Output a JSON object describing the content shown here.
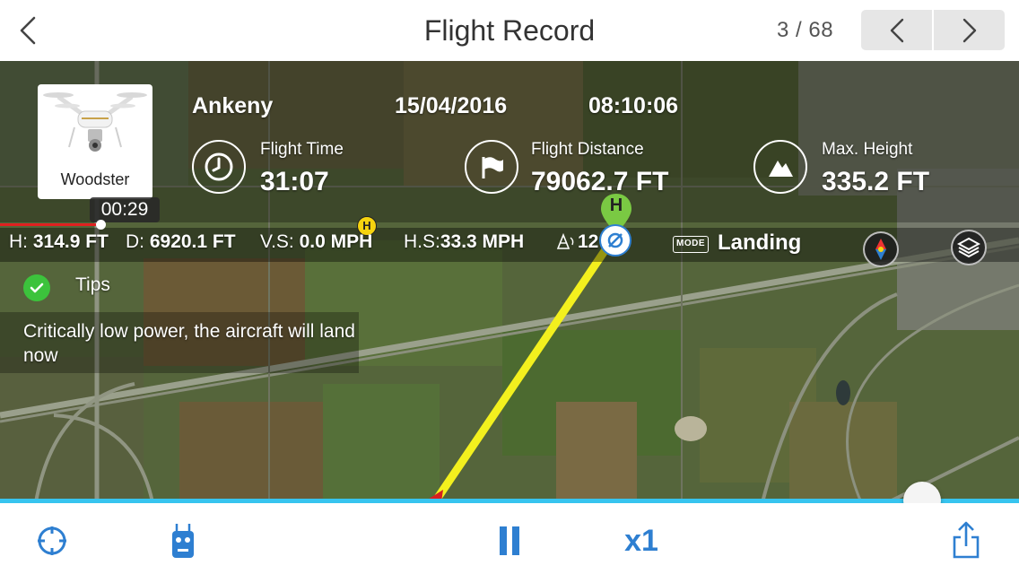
{
  "header": {
    "title": "Flight Record",
    "counter": "3 / 68"
  },
  "aircraft": {
    "name": "Woodster"
  },
  "flight": {
    "location": "Ankeny",
    "date": "15/04/2016",
    "time": "08:10:06",
    "flight_time_label": "Flight Time",
    "flight_time_value": "31:07",
    "flight_distance_label": "Flight Distance",
    "flight_distance_value": "79062.7 FT",
    "max_height_label": "Max. Height",
    "max_height_value": "335.2 FT"
  },
  "playback": {
    "elapsed": "00:29",
    "speed": "x1",
    "progress": 0.905
  },
  "telemetry": {
    "h_label": "H:",
    "h_value": "314.9 FT",
    "d_label": "D:",
    "d_value": "6920.1 FT",
    "vs_label": "V.S:",
    "vs_value": "0.0 MPH",
    "hs_label": "H.S:",
    "hs_value": "33.3 MPH",
    "gps_value": "12",
    "mode_label": "MODE",
    "mode_value": "Landing"
  },
  "tips": {
    "label": "Tips",
    "message": "Critically low power, the aircraft will land now"
  },
  "map_markers": {
    "home_small": "H",
    "home_pin": "H"
  },
  "colors": {
    "accent": "#2e7fd1",
    "track": "#37c4ef",
    "flight_path": "#f3f01e",
    "tips_ok": "#3cc33c",
    "home_pin": "#7ac943"
  },
  "icons": {
    "back": "chevron-left-icon",
    "prev": "chevron-left-icon",
    "next": "chevron-right-icon",
    "flight_time": "clock-icon",
    "flight_distance": "flag-icon",
    "max_height": "mountain-icon",
    "locate": "crosshair-icon",
    "remote": "remote-controller-icon",
    "pause": "pause-icon",
    "share": "share-icon",
    "compass": "compass-icon",
    "layers": "layers-icon"
  }
}
